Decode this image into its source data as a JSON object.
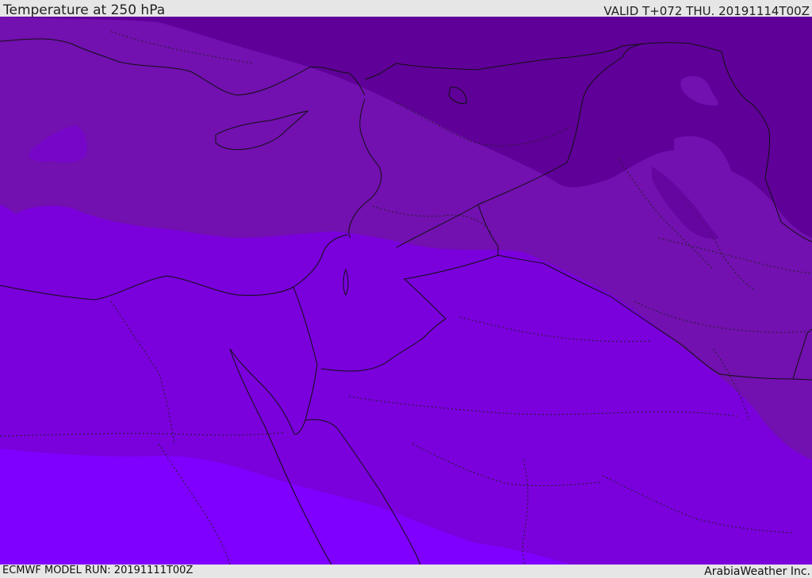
{
  "header": {
    "title": "Temperature at 250 hPa",
    "valid": "VALID T+072 THU. 20191114T00Z"
  },
  "footer": {
    "run": "ECMWF MODEL RUN: 20191111T00Z",
    "credit": "ArabiaWeather Inc."
  },
  "colors": {
    "band_darkest": "#5f0098",
    "band_dark": "#7210b0",
    "band_mid": "#7a00dc",
    "band_light": "#7f00ff",
    "boundary_line": "#111111",
    "panel": "#e6e6e6"
  }
}
